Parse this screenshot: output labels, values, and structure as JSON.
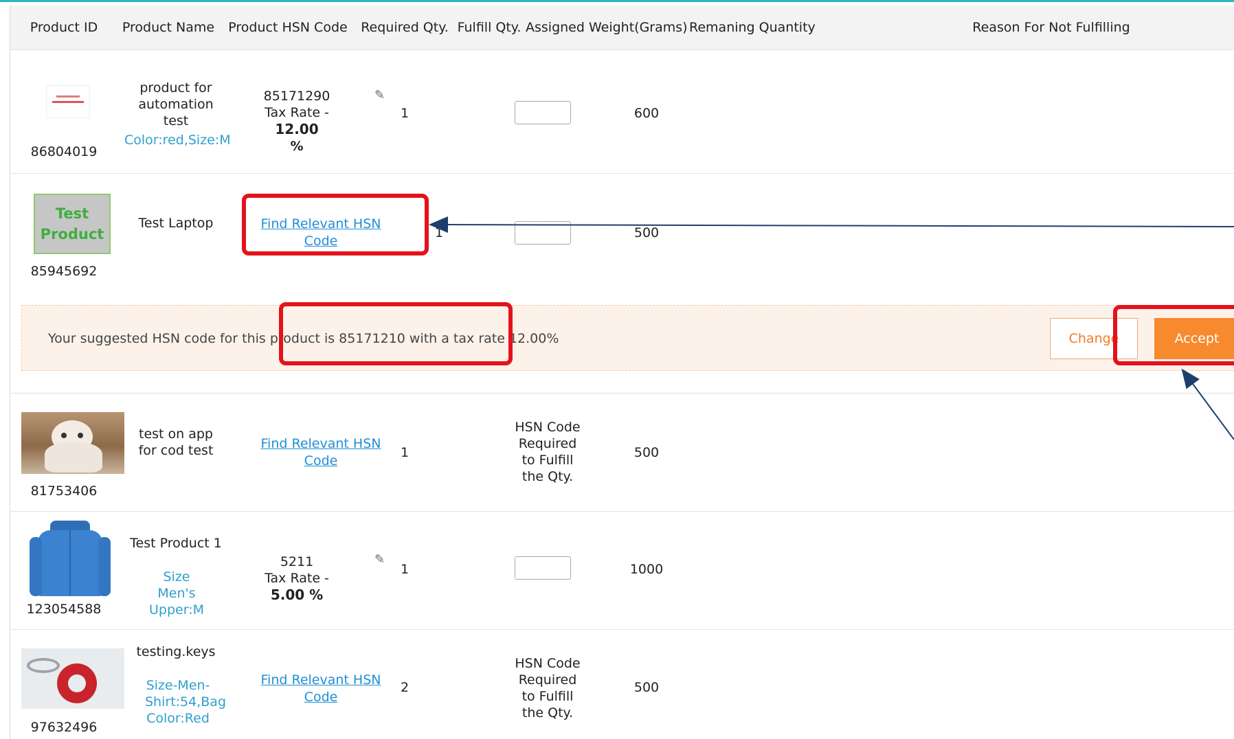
{
  "header": {
    "product_id": "Product ID",
    "product_name": "Product Name",
    "hsn_code": "Product HSN Code",
    "required_qty": "Required Qty.",
    "fulfill_qty": "Fulfill Qty.",
    "assigned_weight": "Assigned Weight(Grams)",
    "remaining_qty": "Remaning Quantity",
    "reason": "Reason For Not Fulfilling"
  },
  "rows": [
    {
      "id": "86804019",
      "name": "product for automation test",
      "variant": "Color:red,Size:M",
      "hsn": "85171290",
      "tax_prefix": "Tax Rate - ",
      "tax_value": "12.00",
      "tax_suffix": "%",
      "required": "1",
      "weight": "600"
    },
    {
      "id": "85945692",
      "name": "Test Laptop",
      "hsn_link": "Find Relevant HSN Code",
      "required": "1",
      "weight": "500",
      "thumb_text": "Test Product"
    },
    {
      "id": "81753406",
      "name": "test on app for cod test",
      "hsn_link": "Find Relevant HSN Code",
      "required": "1",
      "fulfill_note": "HSN Code Required to Fulfill the Qty.",
      "weight": "500"
    },
    {
      "id": "123054588",
      "name": "Test Product 1",
      "variant": "Size Men's Upper:M",
      "hsn": "5211",
      "tax_prefix": "Tax Rate - ",
      "tax_value": "5.00 %",
      "required": "1",
      "weight": "1000"
    },
    {
      "id": "97632496",
      "name": "testing.keys",
      "variant": "Size-Men-Shirt:54,Bag Color:Red",
      "hsn_link": "Find Relevant HSN Code",
      "required": "2",
      "fulfill_note": "HSN Code Required to Fulfill the Qty.",
      "weight": "500"
    }
  ],
  "suggestion": {
    "text": "Your suggested HSN code for this product is 85171210 with a tax rate 12.00%",
    "change_label": "Change",
    "accept_label": "Accept"
  },
  "colors": {
    "accent": "#f7892e",
    "link": "#1f8fd6",
    "annotation": "#e3121b",
    "arrow": "#1d3f6e"
  },
  "icons": [
    "pencil-icon",
    "arrow-icon"
  ]
}
